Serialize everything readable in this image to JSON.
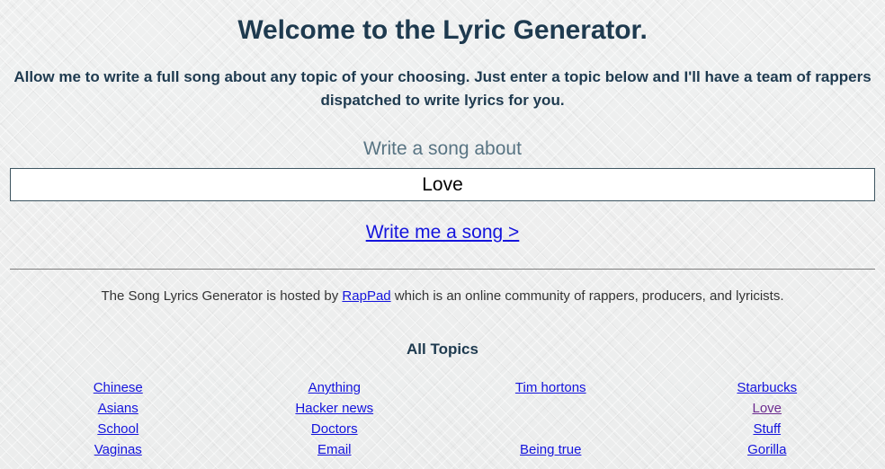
{
  "header": {
    "title": "Welcome to the Lyric Generator.",
    "intro": "Allow me to write a full song about any topic of your choosing. Just enter a topic below and I'll have a team of rappers dispatched to write lyrics for you."
  },
  "form": {
    "label": "Write a song about",
    "input_value": "Love",
    "input_placeholder": "Write a song about",
    "submit_label": "Write me a song >"
  },
  "footer": {
    "note_before": "The Song Lyrics Generator is hosted by ",
    "note_link": "RapPad",
    "note_after": " which is an online community of rappers, producers, and lyricists."
  },
  "topics": {
    "heading": "All Topics",
    "columns": [
      {
        "items": [
          {
            "label": "Chinese",
            "visited": false
          },
          {
            "label": "Asians",
            "visited": false
          },
          {
            "label": "School",
            "visited": false
          },
          {
            "label": "Vaginas",
            "visited": false
          }
        ]
      },
      {
        "items": [
          {
            "label": "Anything",
            "visited": false
          },
          {
            "label": "Hacker news",
            "visited": false
          },
          {
            "label": "Doctors",
            "visited": false
          },
          {
            "label": "Email",
            "visited": false
          }
        ]
      },
      {
        "items": [
          {
            "label": "Tim hortons",
            "visited": false
          },
          {
            "label": "",
            "visited": false
          },
          {
            "label": "",
            "visited": false
          },
          {
            "label": "Being true",
            "visited": false
          }
        ]
      },
      {
        "items": [
          {
            "label": "Starbucks",
            "visited": false
          },
          {
            "label": "Love",
            "visited": true
          },
          {
            "label": "Stuff",
            "visited": false
          },
          {
            "label": "Gorilla",
            "visited": false
          }
        ]
      }
    ]
  },
  "colors": {
    "background": "#eeeeee",
    "text": "#1e3a4f",
    "label": "#587483",
    "link": "#1414dd",
    "link_visited": "#6b2a8f",
    "input_border": "#3d5561",
    "rule": "#7e7e7e"
  }
}
